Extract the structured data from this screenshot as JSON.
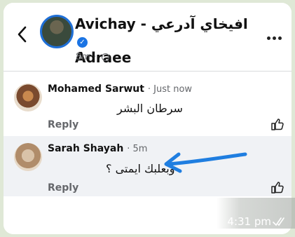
{
  "header": {
    "author_latin_1": "Avichay",
    "author_separator": "-",
    "author_arabic": "افيخاي آدرعي",
    "author_latin_2": "Adraee",
    "timestamp": "8m",
    "icons": {
      "back": "chevron-left-icon",
      "verified": "verified-badge-icon",
      "privacy": "globe-icon",
      "menu": "more-dots-icon"
    }
  },
  "comments": [
    {
      "name": "Mohamed Sarwut",
      "time": "Just now",
      "text": "سرطان البشر",
      "reply_label": "Reply"
    },
    {
      "name": "Sarah Shayah",
      "time": "5m",
      "text": "وبعلبك ايمتى ؟",
      "reply_label": "Reply"
    }
  ],
  "message_meta": {
    "time": "4:31 pm",
    "status_icon": "double-check-icon"
  },
  "colors": {
    "accent": "#1b74e4",
    "arrow": "#1f7ee0",
    "muted": "#65676b"
  }
}
